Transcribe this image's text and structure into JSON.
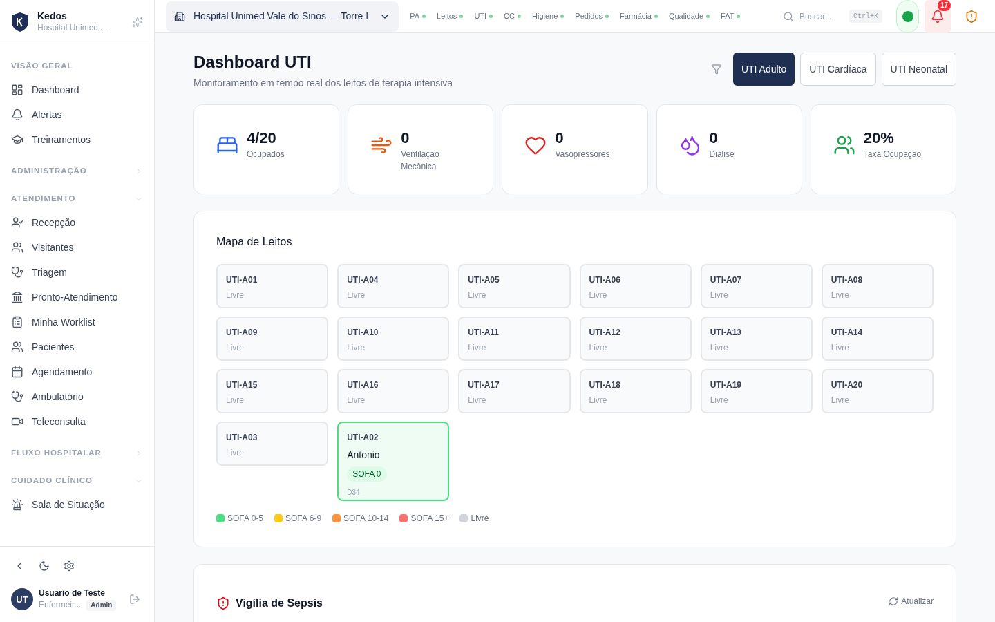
{
  "brand": {
    "name": "Kedos",
    "subtitle": "Hospital Unimed ..."
  },
  "sidebar": {
    "sections": [
      {
        "title": "VISÃO GERAL",
        "items": [
          {
            "label": "Dashboard"
          },
          {
            "label": "Alertas"
          },
          {
            "label": "Treinamentos"
          }
        ]
      },
      {
        "title": "ADMINISTRAÇÃO",
        "expanded": false
      },
      {
        "title": "ATENDIMENTO",
        "expanded": true,
        "items": [
          {
            "label": "Recepção"
          },
          {
            "label": "Visitantes"
          },
          {
            "label": "Triagem"
          },
          {
            "label": "Pronto-Atendimento"
          },
          {
            "label": "Minha Worklist"
          },
          {
            "label": "Pacientes"
          },
          {
            "label": "Agendamento"
          },
          {
            "label": "Ambulatório"
          },
          {
            "label": "Teleconsulta"
          }
        ]
      },
      {
        "title": "FLUXO HOSPITALAR",
        "expanded": false
      },
      {
        "title": "CUIDADO CLÍNICO",
        "expanded": true,
        "items": [
          {
            "label": "Sala de Situação"
          }
        ]
      }
    ]
  },
  "user": {
    "initials": "UT",
    "name": "Usuario de Teste",
    "role": "Enfermeir...",
    "badge": "Admin"
  },
  "topbar": {
    "hospital": "Hospital Unimed Vale do Sinos — Torre I",
    "modules": [
      {
        "label": "PA"
      },
      {
        "label": "Leitos"
      },
      {
        "label": "UTI"
      },
      {
        "label": "CC"
      },
      {
        "label": "Higiene"
      },
      {
        "label": "Pedidos"
      },
      {
        "label": "Farmácia"
      },
      {
        "label": "Qualidade"
      },
      {
        "label": "FAT"
      }
    ],
    "search_placeholder": "Buscar...",
    "shortcut": "Ctrl+K",
    "notifications": "17"
  },
  "page": {
    "title": "Dashboard UTI",
    "subtitle": "Monitoramento em tempo real dos leitos de terapia intensiva",
    "tabs": [
      {
        "label": "UTI Adulto",
        "selected": true
      },
      {
        "label": "UTI Cardíaca",
        "selected": false
      },
      {
        "label": "UTI Neonatal",
        "selected": false
      }
    ]
  },
  "stats": [
    {
      "value": "4/20",
      "label": "Ocupados",
      "color": "#2563eb"
    },
    {
      "value": "0",
      "label": "Ventilação Mecânica",
      "color": "#ea580c"
    },
    {
      "value": "0",
      "label": "Vasopressores",
      "color": "#dc2626"
    },
    {
      "value": "0",
      "label": "Diálise",
      "color": "#9333ea"
    },
    {
      "value": "20%",
      "label": "Taxa Ocupação",
      "color": "#16a34a"
    }
  ],
  "bed_map": {
    "title": "Mapa de Leitos",
    "beds": [
      {
        "kind": "free",
        "id": "UTI-A01",
        "status": "Livre"
      },
      {
        "kind": "free",
        "id": "UTI-A04",
        "status": "Livre"
      },
      {
        "kind": "free",
        "id": "UTI-A05",
        "status": "Livre"
      },
      {
        "kind": "free",
        "id": "UTI-A06",
        "status": "Livre"
      },
      {
        "kind": "free",
        "id": "UTI-A07",
        "status": "Livre"
      },
      {
        "kind": "free",
        "id": "UTI-A08",
        "status": "Livre"
      },
      {
        "kind": "free",
        "id": "UTI-A09",
        "status": "Livre"
      },
      {
        "kind": "free",
        "id": "UTI-A10",
        "status": "Livre"
      },
      {
        "kind": "free",
        "id": "UTI-A11",
        "status": "Livre"
      },
      {
        "kind": "free",
        "id": "UTI-A12",
        "status": "Livre"
      },
      {
        "kind": "free",
        "id": "UTI-A13",
        "status": "Livre"
      },
      {
        "kind": "free",
        "id": "UTI-A14",
        "status": "Livre"
      },
      {
        "kind": "free",
        "id": "UTI-A15",
        "status": "Livre"
      },
      {
        "kind": "free",
        "id": "UTI-A16",
        "status": "Livre"
      },
      {
        "kind": "free",
        "id": "UTI-A17",
        "status": "Livre"
      },
      {
        "kind": "free",
        "id": "UTI-A18",
        "status": "Livre"
      },
      {
        "kind": "free",
        "id": "UTI-A19",
        "status": "Livre"
      },
      {
        "kind": "free",
        "id": "UTI-A20",
        "status": "Livre"
      },
      {
        "kind": "free",
        "id": "UTI-A03",
        "status": "Livre"
      },
      {
        "kind": "occupied",
        "id": "UTI-A02",
        "patient": "Antonio",
        "sofa": "SOFA 0",
        "day": "D34",
        "color": "#4ade80"
      }
    ],
    "legend": [
      {
        "label": "SOFA 0-5",
        "color": "#4ade80"
      },
      {
        "label": "SOFA 6-9",
        "color": "#facc15"
      },
      {
        "label": "SOFA 10-14",
        "color": "#fb923c"
      },
      {
        "label": "SOFA 15+",
        "color": "#f87171"
      },
      {
        "label": "Livre",
        "color": "#d1d5db"
      }
    ]
  },
  "sepsis": {
    "title": "Vigília de Sepsis",
    "refresh": "Atualizar"
  }
}
